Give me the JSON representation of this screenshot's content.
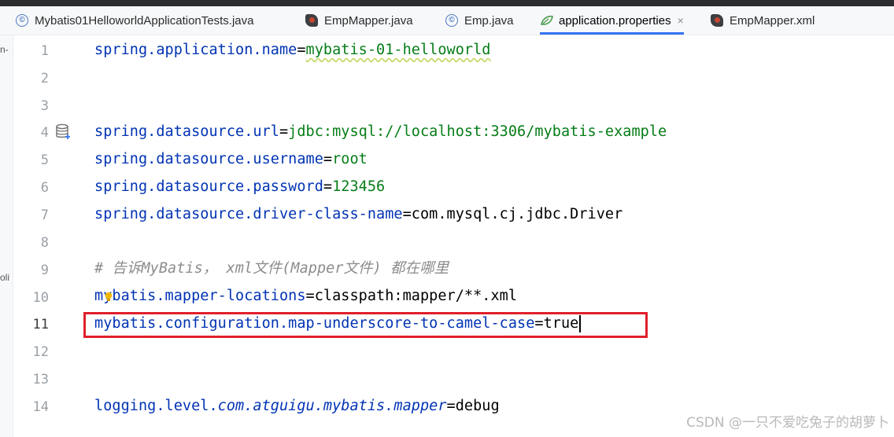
{
  "tabs": [
    {
      "label": "Mybatis01HelloworldApplicationTests.java",
      "icon": "class-icon",
      "active": false
    },
    {
      "label": "EmpMapper.java",
      "icon": "mapper-icon",
      "active": false
    },
    {
      "label": "Emp.java",
      "icon": "class-icon",
      "active": false
    },
    {
      "label": "application.properties",
      "icon": "properties-icon",
      "active": true,
      "close": "×"
    },
    {
      "label": "EmpMapper.xml",
      "icon": "mapper-icon",
      "active": false
    }
  ],
  "side_fragments": [
    "n-",
    "oli"
  ],
  "editor": {
    "current_line": 11,
    "lines": [
      {
        "num": "1",
        "key": "spring.application.name",
        "eq": "=",
        "val": "mybatis-01-helloworld"
      },
      {
        "num": "2"
      },
      {
        "num": "3"
      },
      {
        "num": "4",
        "key": "spring.datasource.url",
        "eq": "=",
        "val": "jdbc:mysql://localhost:3306/mybatis-example"
      },
      {
        "num": "5",
        "key": "spring.datasource.username",
        "eq": "=",
        "val": "root"
      },
      {
        "num": "6",
        "key": "spring.datasource.password",
        "eq": "=",
        "val": "123456"
      },
      {
        "num": "7",
        "key": "spring.datasource.driver-class-name",
        "eq": "=",
        "val": "com.mysql.cj.jdbc.Driver"
      },
      {
        "num": "8"
      },
      {
        "num": "9",
        "comment": "# 告诉MyBatis， xml文件(Mapper文件) 都在哪里"
      },
      {
        "num": "10",
        "key": "mybatis.mapper-locations",
        "eq": "=",
        "val": "classpath:mapper/**.xml"
      },
      {
        "num": "11",
        "key": "mybatis.configuration.map-underscore-to-camel-case",
        "eq": "=",
        "val": "true"
      },
      {
        "num": "12"
      },
      {
        "num": "13"
      },
      {
        "num": "14",
        "key_a": "logging.level.",
        "key_b": "com.atguigu.mybatis.mapper",
        "eq": "=",
        "val": "debug"
      }
    ]
  },
  "watermark": "CSDN @一只不爱吃兔子的胡萝卜",
  "colors": {
    "key": "#0033b3",
    "value": "#067d17",
    "highlight_box": "#e0202a",
    "active_tab_underline": "#3574f0"
  }
}
